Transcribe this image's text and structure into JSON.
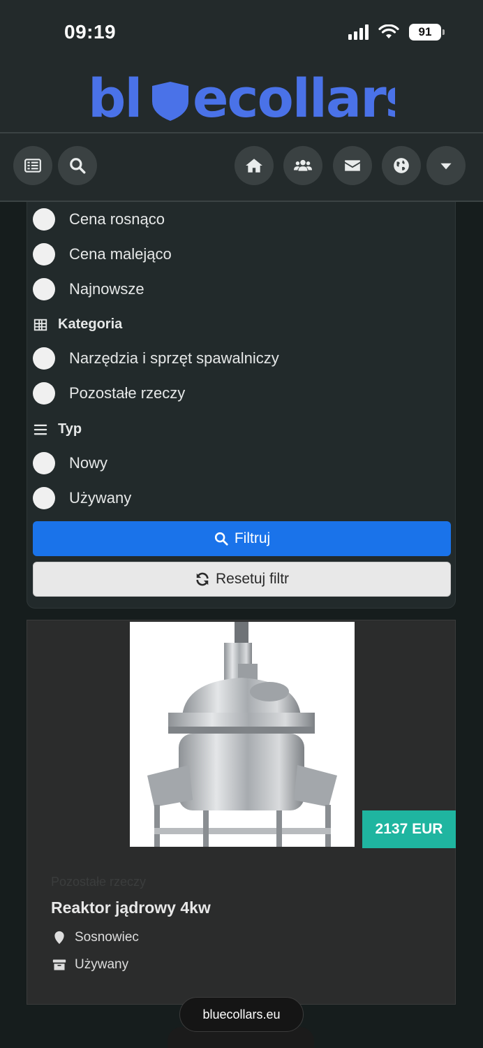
{
  "status_bar": {
    "time": "09:19",
    "battery": "91"
  },
  "brand": {
    "logo_text": "blecollars"
  },
  "nav": {
    "icons": [
      "menu-list-icon",
      "search-icon",
      "home-icon",
      "users-icon",
      "mail-icon",
      "globe-icon",
      "dropdown-icon"
    ]
  },
  "sort_options": [
    {
      "label": "Cena rosnąco"
    },
    {
      "label": "Cena malejąco"
    },
    {
      "label": "Najnowsze"
    }
  ],
  "category_section": {
    "heading": "Kategoria",
    "options": [
      {
        "label": "Narzędzia i sprzęt spawalniczy"
      },
      {
        "label": "Pozostałe rzeczy"
      }
    ]
  },
  "type_section": {
    "heading": "Typ",
    "options": [
      {
        "label": "Nowy"
      },
      {
        "label": "Używany"
      }
    ]
  },
  "buttons": {
    "filter": "Filtruj",
    "reset": "Resetuj filtr"
  },
  "listing": {
    "price": "2137 EUR",
    "category": "Pozostałe rzeczy",
    "title": "Reaktor jądrowy 4kw",
    "location": "Sosnowiec",
    "condition": "Używany"
  },
  "browser": {
    "url": "bluecollars.eu"
  },
  "colors": {
    "brand_blue": "#4a72e8",
    "filter_button": "#1a73ea",
    "price_badge": "#1fb5a0"
  }
}
